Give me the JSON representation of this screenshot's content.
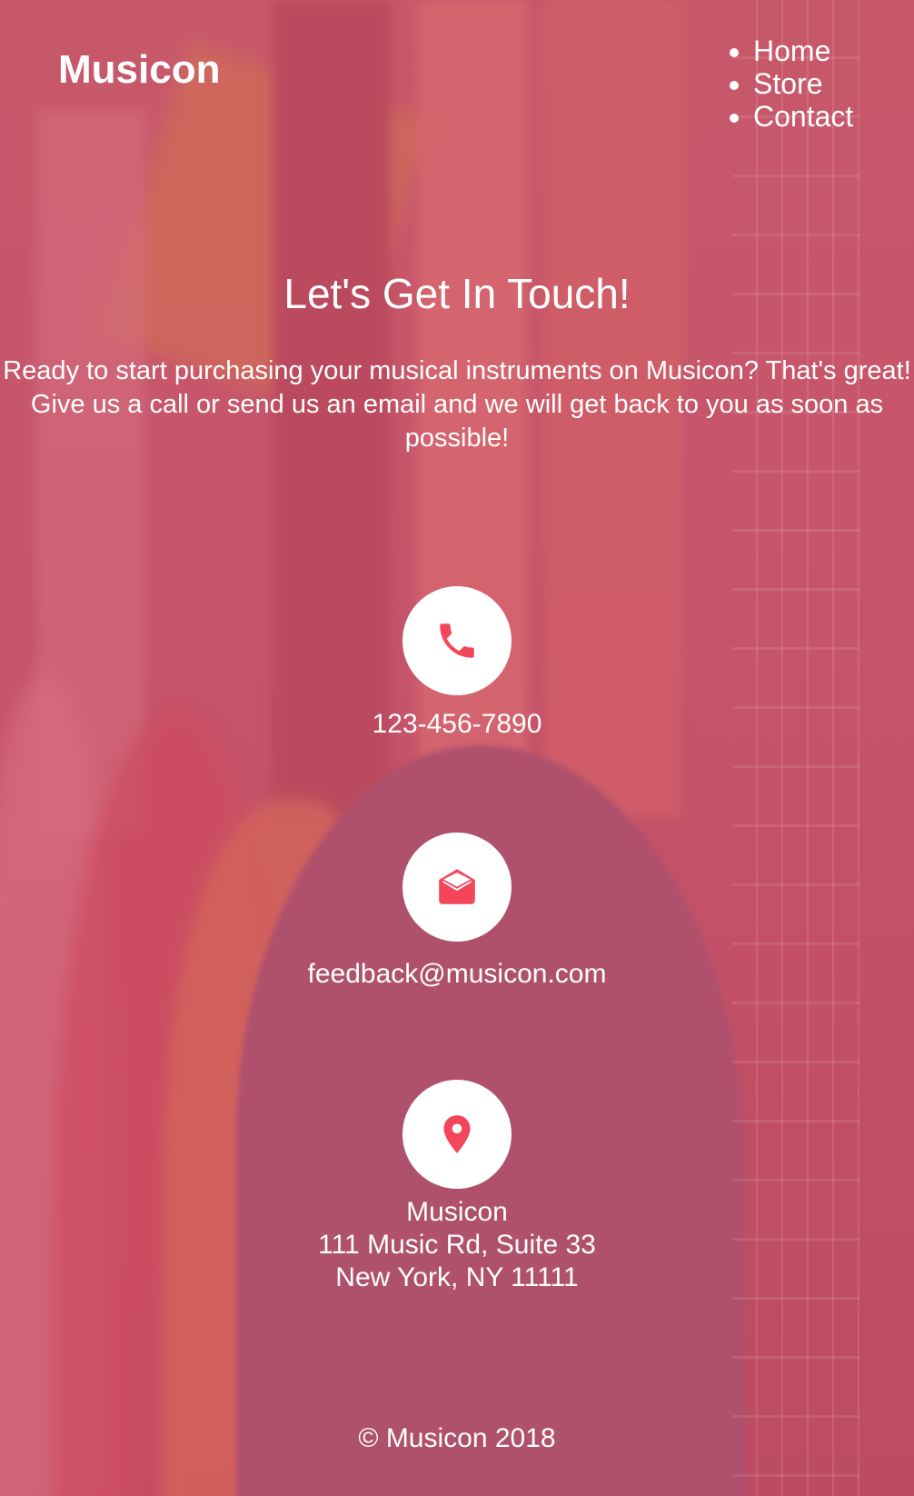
{
  "header": {
    "logo": "Musicon",
    "nav": [
      {
        "label": "Home"
      },
      {
        "label": "Store"
      },
      {
        "label": "Contact"
      }
    ]
  },
  "main": {
    "title": "Let's Get In Touch!",
    "intro": "Ready to start purchasing your musical instruments on Musicon? That's great! Give us a call or send us an email and we will get back to you as soon as possible!",
    "phone": {
      "icon": "phone-icon",
      "value": "123-456-7890"
    },
    "email": {
      "icon": "envelope-open-icon",
      "value": "feedback@musicon.com"
    },
    "address": {
      "icon": "map-pin-icon",
      "name": "Musicon",
      "street": "111 Music Rd, Suite 33",
      "city": "New York, NY 11111"
    }
  },
  "footer": {
    "text": "© Musicon 2018"
  },
  "colors": {
    "accent": "#f4465b",
    "overlay": "#c65d70",
    "icon_bg": "#ffffff"
  }
}
